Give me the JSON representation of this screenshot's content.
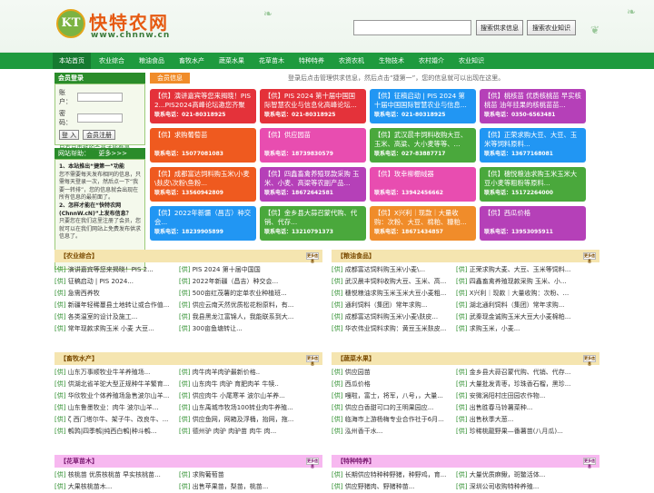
{
  "header": {
    "logo_mark": "KT",
    "site_name": "快特农网",
    "site_url": "www.chnnw.cn",
    "search_supply": "搜索供求信息",
    "search_knowledge": "搜索农业知识"
  },
  "nav": [
    "本站首页",
    "农业综合",
    "粮油食品",
    "畜牧水产",
    "蔬菜水果",
    "花草苗木",
    "特种特养",
    "农资农机",
    "生物技术",
    "农村婚介",
    "农业知识"
  ],
  "login": {
    "title": "会员登录",
    "user_label": "账户：",
    "pass_label": "密码：",
    "login_btn": "登 入",
    "register_btn": "会员注册",
    "note": "只有已审核的会员才能登录"
  },
  "tips": {
    "title": "网站帮助：",
    "more": "更多>>>",
    "q1": "1、本站推出“捷第一”功能",
    "a1": "您不需要每天发布相同的信息，只需每天登录一次，然后点一下“我要一转排”，您的信息就会出现在所有信息的最前面了。",
    "q2": "2、怎样才能在“快特农网(ChnnW.cN)”上发布信息？",
    "a2": "只要您在我们这里注册了会员，您就可以在我们网站上免费发布供求信息了。"
  },
  "notice": {
    "tag": "会员信息",
    "text": "登录后点击管理供求信息，然后点击“捷第一”，您的信息就可以出现在这里。"
  },
  "tiles": [
    {
      "tag": "供",
      "title": "演讲嘉宾等您来揭晓！PIS 2...PIS2024高峰论坛邀您齐聚杭州一...",
      "contact": "联系电话：021-80318925",
      "color": "#e4323a"
    },
    {
      "tag": "供",
      "title": "PIS 2024 第十届中国国际智慧农业与信息化高峰论坛...",
      "contact": "联系电话：021-80318925",
      "color": "#e4323a"
    },
    {
      "tag": "供",
      "title": "征稿启动 | PIS 2024 第十届中国国际智慧农业与信息...",
      "contact": "联系电话：021-80318925",
      "color": "#2196f3"
    },
    {
      "tag": "供",
      "title": "桃核苗 优质核桃苗 早实核桃苗 油年挂果的核桃苗苗...",
      "contact": "联系电话：0350-6563481",
      "color": "#b540b8"
    },
    {
      "tag": "供",
      "title": "求购葡萄苗",
      "contact": "联系电话：15077081083",
      "color": "#ef5a1f"
    },
    {
      "tag": "供",
      "title": "供应园苗",
      "contact": "联系电话：18739830579",
      "color": "#e84db0"
    },
    {
      "tag": "供",
      "title": "武汉晨丰饲料收购大豆、玉米、高粱、大小麦等等、...",
      "contact": "联系电话：027-83887717",
      "color": "#4aa83c"
    },
    {
      "tag": "供",
      "title": "正荣求购大豆、大豆、玉米等饲料原料...",
      "contact": "联系电话：13677168081",
      "color": "#2196f3"
    },
    {
      "tag": "供",
      "title": "成都富达饲料购玉米\\小麦\\麸皮\\次粉\\鱼粉...",
      "contact": "联系电话：13560942809",
      "color": "#ef5a1f"
    },
    {
      "tag": "供",
      "title": "四鑫畜禽养殖现款采购 玉米、小麦、高粱等农副产品...",
      "contact": "联系电话：18672642581",
      "color": "#b540b8"
    },
    {
      "tag": "供",
      "title": "玫幸柳棚绒器",
      "contact": "联系电话：13942456662",
      "color": "#e84db0"
    },
    {
      "tag": "供",
      "title": "穗悦粮油求购玉米玉米大豆小麦等粗粉等原料...",
      "contact": "联系电话：15172264000",
      "color": "#4aa83c"
    },
    {
      "tag": "供",
      "title": "2022年新疆（昌吉）种交会...",
      "contact": "联系电话：18239905899",
      "color": "#2196f3"
    },
    {
      "tag": "供",
      "title": "金乡县大蒜召蒙代购、代销、代存...",
      "contact": "联系电话：13210791373",
      "color": "#4aa83c"
    },
    {
      "tag": "供",
      "title": "X兴利｜现款｜大量收购：次粉、大豆、棉粕、糠粕...",
      "contact": "联系电话：18671434857",
      "color": "#f08c2a"
    },
    {
      "tag": "供",
      "title": "西瓜价格",
      "contact": "联系电话：13953095911",
      "color": "#b540b8"
    }
  ],
  "sections": [
    {
      "title": "【农业综合】",
      "more": "更多信息",
      "color": "#f5e5b0",
      "fg": "#7a4a00",
      "left": [
        "演讲嘉宾等您来揭晓！PIS 2...",
        "征稿启动 | PIS 2024...",
        "急需西养牧",
        "新疆年轻稀蔓县土地转让或合作值...",
        "各类温室的设计及施工...",
        "常年现款求购玉米 小麦 大豆..."
      ],
      "right": [
        "PIS 2024 第十届中国国",
        "2022年新疆（昌吉）种交会...",
        "500亩红茂薯的定单农业种植班...",
        "供应云南天然优质松花粉原料，有...",
        "我县黑龙江富锦人，我能联系到大...",
        "300亩鱼塘转让..."
      ]
    },
    {
      "title": "【粮油食品】",
      "more": "更多信息",
      "color": "#f5e5b0",
      "fg": "#7a4a00",
      "left": [
        "成都富达饲料购玉米\\小麦\\...",
        "武汉晨丰饲料收购大豆、玉米、高...",
        "穗悦粮油求购玉米玉米大豆小麦粗...",
        "通利饲料（集团）常年求购...",
        "成都富达饲料购玉米\\小麦\\麸皮...",
        "华农伟业饲料求购：黄豆玉米麸皮..."
      ],
      "right": [
        "正荣求购大麦、大豆、玉米等饲料...",
        "四鑫畜禽养殖现款采购 玉米、小...",
        "X兴利｜现款｜大量收购：次粉、...",
        "湖北通利饲料（集团）常年求购...",
        "武秦现金诚购玉米大豆大小麦棉粕...",
        "求购玉米，小麦..."
      ]
    },
    {
      "title": "【畜牧水产】",
      "more": "更多信息",
      "color": "#f5e5b0",
      "fg": "#7a4a00",
      "left": [
        "山东万事顺牧业牛羊养殖场...",
        "供湖北省羊驼大型正规种牛羊繁育...",
        "华欣牧业个体养殖场急售波尔山羊...",
        "山东鲁墨牧业：肉牛 波尔山羊...",
        "ζ 西门塔尔牛、架子牛、改良牛、...",
        "鹌鹑|四季鹌|纯西白鹌|种斗鹌..."
      ],
      "right": [
        "肉牛肉羊肉驴最新价格..",
        "山东肉牛 肉驴 育肥肉羊 牛犊..",
        "供应肉牛 小尾寒羊 波尔山羊养...",
        "山东禹城市牧场100转业肉牛养殖...",
        "供应鱼网，网箱及浮桶，抬网，拖...",
        "德州驴 肉驴 肉驴苗 肉牛 肉..."
      ]
    },
    {
      "title": "【蔬菜水果】",
      "more": "更多信息",
      "color": "#f5e5b0",
      "fg": "#7a4a00",
      "left": [
        "供应园苗",
        "西瓜价格",
        "嘎啦，富士，将军，八号，，大量...",
        "供应白香甜可口的王明果园应...",
        "临海市上游杨梅专业合作社于6月...",
        "泓州香干水..."
      ],
      "right": [
        "金乡县大蒜召蒙代购、代销、代存...",
        "大量批发青枣，珍珠香石榴，黑珍...",
        "安微涡阳村庄田园农作物...",
        "出售胜春马铃薯菜种...",
        "出售秋季大葱...",
        "珍稀桃龍野果—番薯苗(八月瓜)..."
      ]
    },
    {
      "title": "【花草苗木】",
      "more": "更多信息",
      "color": "#f7b8f0",
      "fg": "#7a1a70",
      "left": [
        "核桃苗 优质核桃苗 早实核桃苗...",
        "大果核桃苗木..."
      ],
      "right": [
        "求购葡萄苗",
        "出售苹果苗，梨苗，桃苗..."
      ]
    },
    {
      "title": "【特种特养】",
      "more": "更多信息",
      "color": "#f7b8f0",
      "fg": "#7a1a70",
      "left": [
        "长期供应特种种野猪，种野鸡，育...",
        "供应野猪肉、野猪种苗..."
      ],
      "right": [
        "大量优质麻鳅，斑鳖活体...",
        "深圳公司收购特种养殖..."
      ]
    }
  ]
}
